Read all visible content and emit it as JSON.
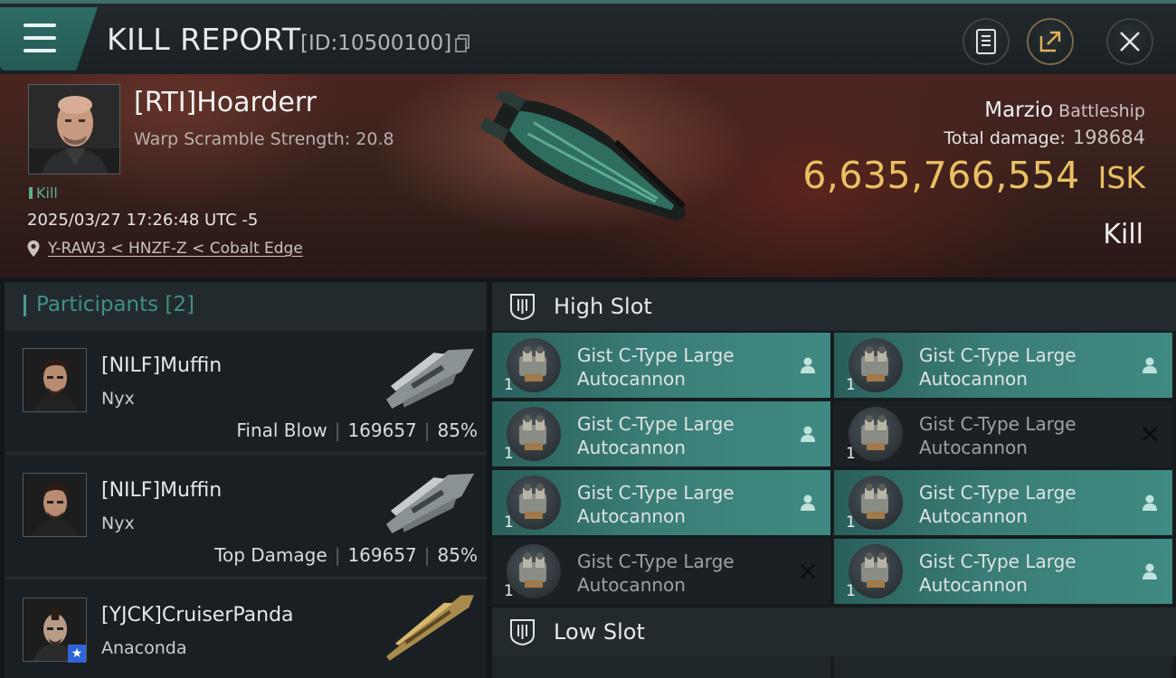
{
  "header": {
    "title": "KILL REPORT",
    "report_id": "[ID:10500100]"
  },
  "victim": {
    "name": "[RTI]Hoarderr",
    "warp_scramble": "Warp Scramble Strength: 20.8",
    "tag": "Kill",
    "timestamp": "2025/03/27 17:26:48 UTC -5",
    "location": "Y-RAW3 < HNZF-Z < Cobalt Edge",
    "ship_name": "Marzio",
    "ship_class": "Battleship",
    "damage_label": "Total damage:",
    "damage_value": "198684",
    "isk_value": "6,635,766,554",
    "isk_unit": "ISK",
    "result": "Kill"
  },
  "participants": {
    "title": "Participants",
    "count": "[2]",
    "items": [
      {
        "name": "[NILF]Muffin",
        "ship": "Nyx",
        "role": "Final Blow",
        "damage": "169657",
        "percent": "85%"
      },
      {
        "name": "[NILF]Muffin",
        "ship": "Nyx",
        "role": "Top Damage",
        "damage": "169657",
        "percent": "85%"
      },
      {
        "name": "[YJCK]CruiserPanda",
        "ship": "Anaconda",
        "role": "",
        "damage": "",
        "percent": ""
      }
    ]
  },
  "high_slot": {
    "title": "High Slot",
    "modules": [
      {
        "line1": "Gist C-Type Large",
        "line2": "Autocannon",
        "qty": "1",
        "status": "fitted"
      },
      {
        "line1": "Gist C-Type Large",
        "line2": "Autocannon",
        "qty": "1",
        "status": "fitted"
      },
      {
        "line1": "Gist C-Type Large",
        "line2": "Autocannon",
        "qty": "1",
        "status": "fitted"
      },
      {
        "line1": "Gist C-Type Large",
        "line2": "Autocannon",
        "qty": "1",
        "status": "destroyed"
      },
      {
        "line1": "Gist C-Type Large",
        "line2": "Autocannon",
        "qty": "1",
        "status": "fitted"
      },
      {
        "line1": "Gist C-Type Large",
        "line2": "Autocannon",
        "qty": "1",
        "status": "fitted"
      },
      {
        "line1": "Gist C-Type Large",
        "line2": "Autocannon",
        "qty": "1",
        "status": "destroyed"
      },
      {
        "line1": "Gist C-Type Large",
        "line2": "Autocannon",
        "qty": "1",
        "status": "fitted"
      }
    ]
  },
  "low_slot": {
    "title": "Low Slot"
  },
  "colors": {
    "accent_teal": "#3f8a82",
    "isk_gold": "#e8c063",
    "kill_green": "#5fae90"
  }
}
